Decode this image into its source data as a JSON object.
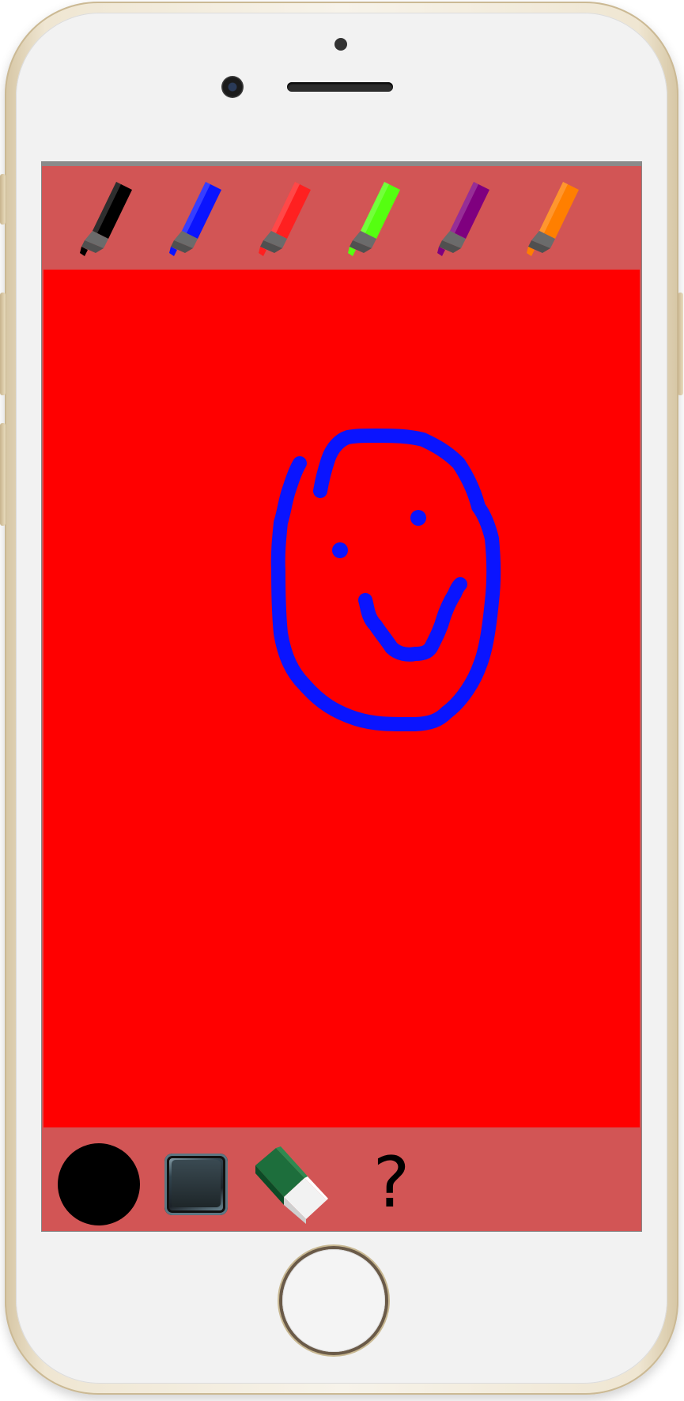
{
  "app": {
    "bottom_toolbar": {
      "current_color": "#000000",
      "help_label": "?"
    },
    "markers": [
      {
        "name": "black",
        "color": "#000000"
      },
      {
        "name": "blue",
        "color": "#0a14ff"
      },
      {
        "name": "red",
        "color": "#ff2020"
      },
      {
        "name": "green",
        "color": "#55ff10"
      },
      {
        "name": "purple",
        "color": "#7f007f"
      },
      {
        "name": "orange",
        "color": "#ff7f00"
      }
    ],
    "canvas": {
      "background_color": "#ff0000",
      "drawing_color": "#0a14ff",
      "drawing": "smiley-face"
    }
  },
  "device": {
    "frame_color": "#efe6d2"
  }
}
